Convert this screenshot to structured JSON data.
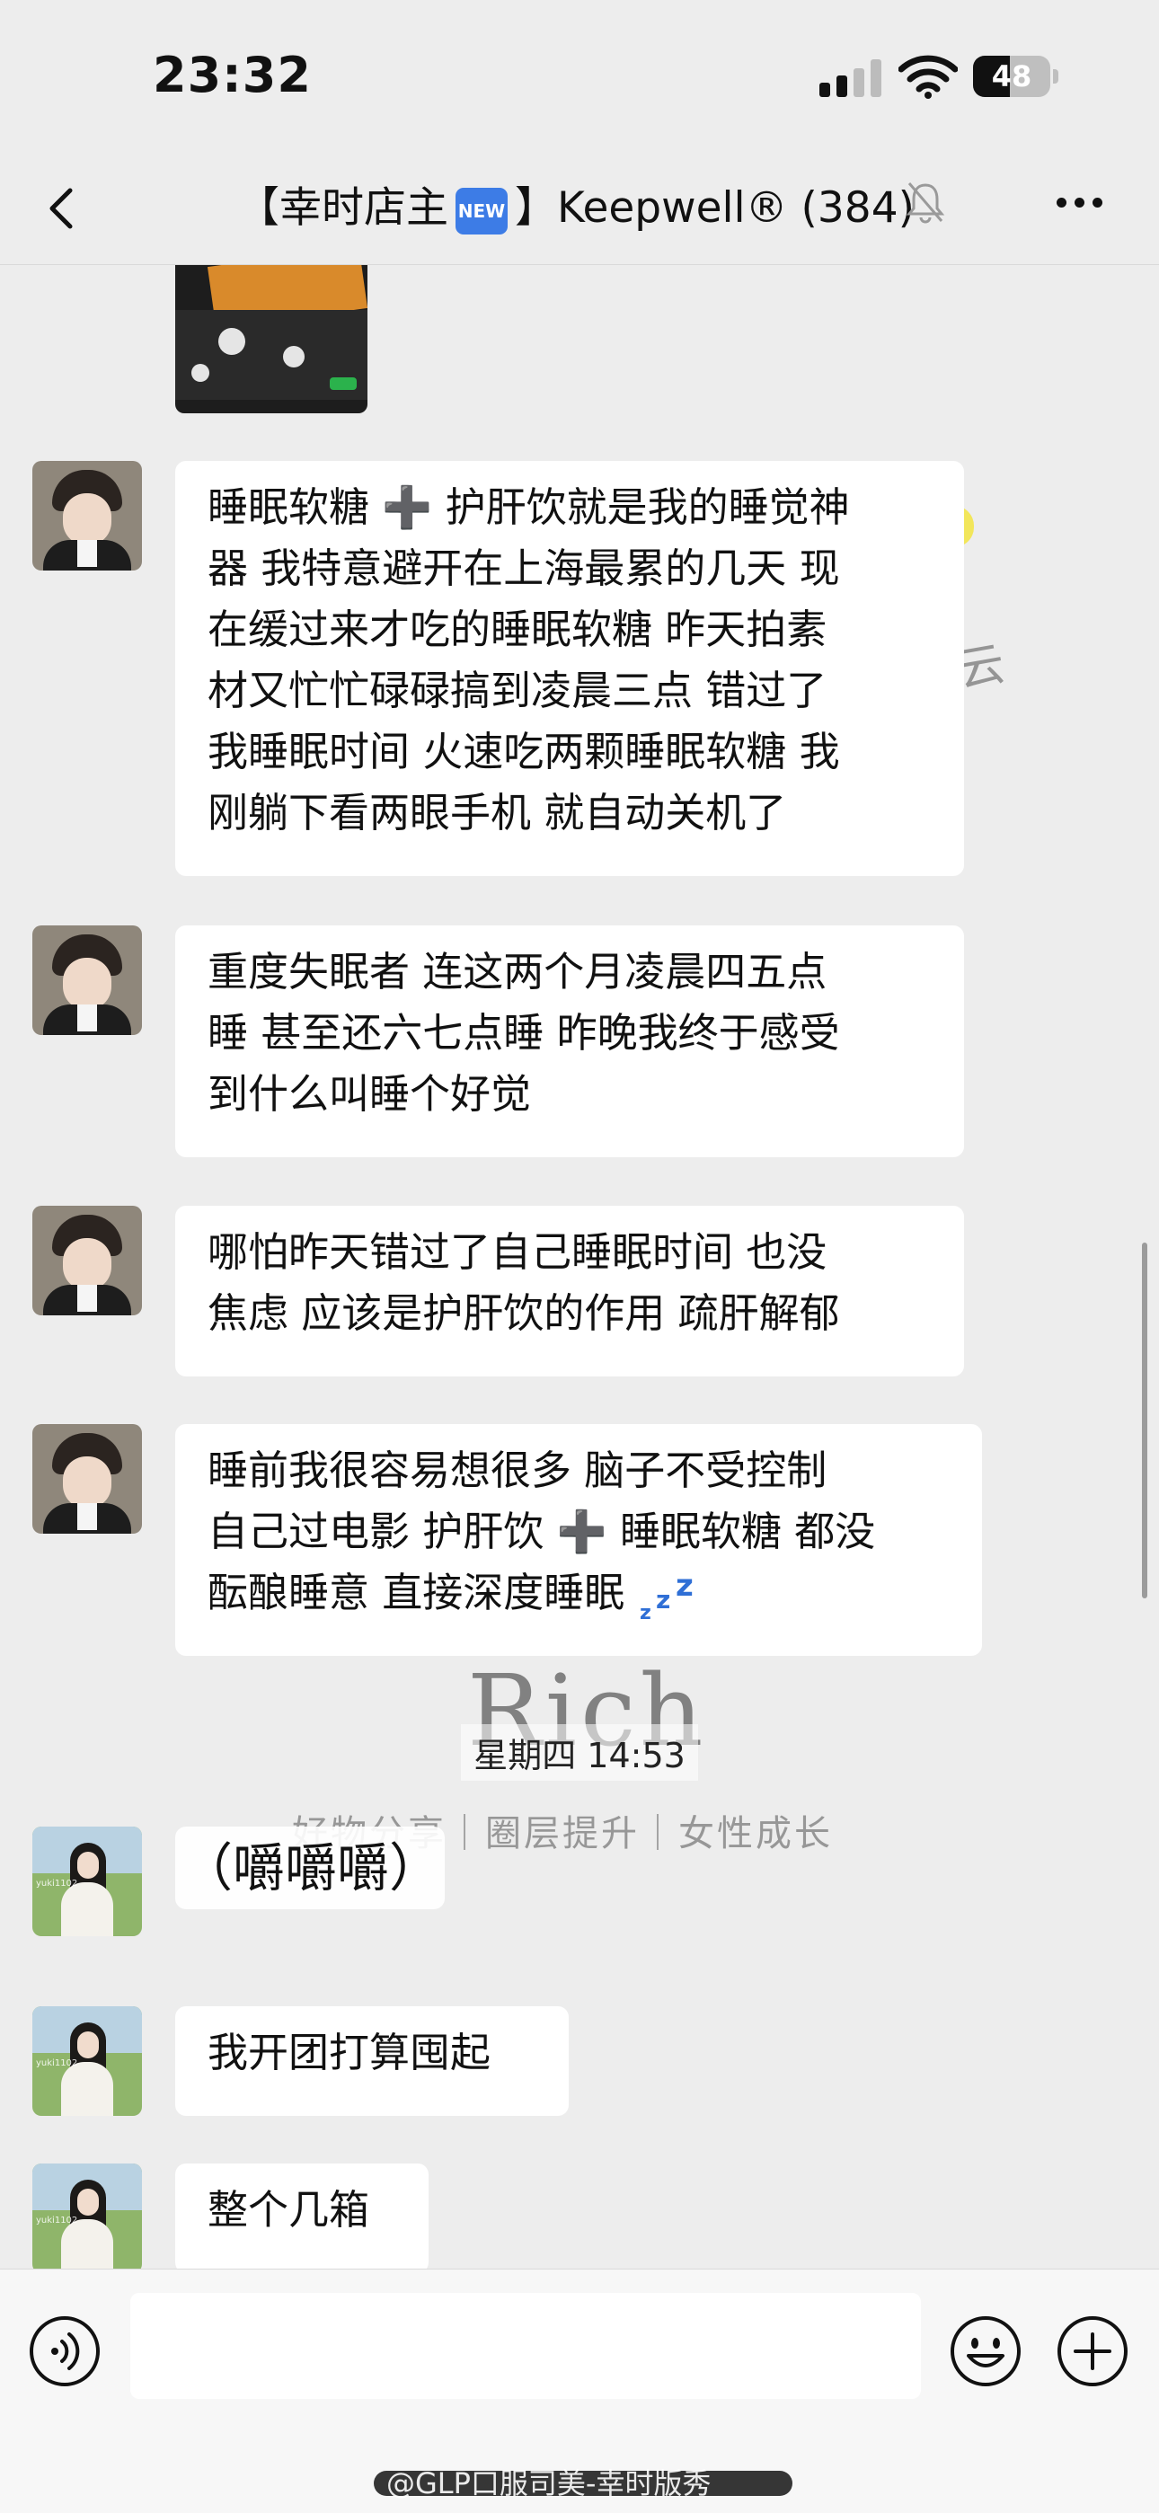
{
  "status_bar": {
    "time": "23:32",
    "battery": "48",
    "battery_level_percent": 48
  },
  "nav": {
    "title_prefix": "【幸时店主",
    "new_badge": "NEW",
    "title_suffix": "】Keepwell® (384)"
  },
  "messages": [
    {
      "lines": [
        "睡眠软糖 ➕ 护肝饮就是我的睡觉神",
        "器 我特意避开在上海最累的几天 现",
        "在缓过来才吃的睡眠软糖 昨天拍素",
        "材又忙忙碌碌搞到凌晨三点 错过了",
        "我睡眠时间 火速吃两颗睡眠软糖 我",
        "刚躺下看两眼手机 就自动关机了"
      ]
    },
    {
      "lines": [
        "重度失眠者 连这两个月凌晨四五点",
        "睡 甚至还六七点睡 昨晚我终于感受",
        "到什么叫睡个好觉"
      ]
    },
    {
      "lines": [
        "哪怕昨天错过了自己睡眠时间 也没",
        "焦虑 应该是护肝饮的作用 疏肝解郁"
      ]
    },
    {
      "lines": [
        "睡前我很容易想很多 脑子不受控制",
        "自己过电影 护肝饮 ➕ 睡眠软糖 都没"
      ],
      "last_line": "酝酿睡意 直接深度睡眠",
      "sleep_emoji": "zzz"
    },
    {
      "text": "（嚼嚼嚼）"
    },
    {
      "text": "我开团打算囤起"
    },
    {
      "text": "整个几箱"
    }
  ],
  "timestamp": "星期四 14:53",
  "watermarks": {
    "brand": "Rich",
    "tagline": "好物分享｜圈层提升｜女性成长",
    "side_char": "云",
    "footer": "@GLP口服司美-幸时版秀"
  },
  "avatar_caption": "yuki1102",
  "icons": [
    "back-chevron-icon",
    "mute-bell-icon",
    "more-dots-icon",
    "voice-icon",
    "emoji-icon",
    "plus-icon"
  ]
}
